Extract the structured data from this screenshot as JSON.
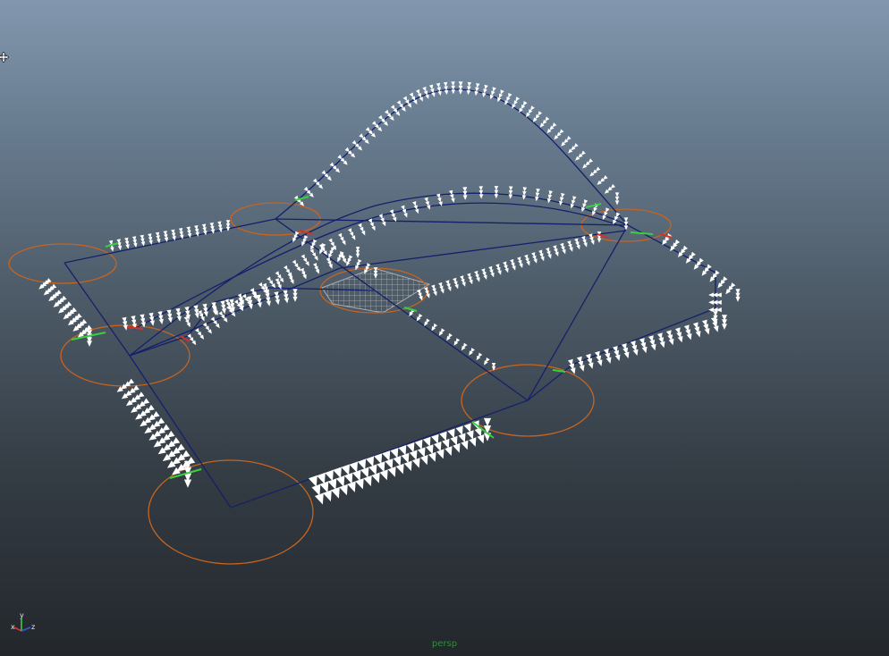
{
  "viewport": {
    "camera_label": "persp",
    "background_top": "#8297ad",
    "background_bottom": "#23272c"
  },
  "axis_gizmo": {
    "x_label": "x",
    "y_label": "y",
    "z_label": "z",
    "x_color": "#e03a3a",
    "y_color": "#3fd24a",
    "z_color": "#3a5ae0"
  },
  "colors": {
    "curve": "#14206a",
    "arrows": "#ffffff",
    "control_circle": "#c8641e",
    "marker_green": "#36d23c",
    "marker_red": "#d2322a",
    "grid_patch": "#a0a0a0"
  },
  "icons": {
    "cursor": "move-cursor-icon",
    "gizmo": "axis-gizmo-icon"
  }
}
